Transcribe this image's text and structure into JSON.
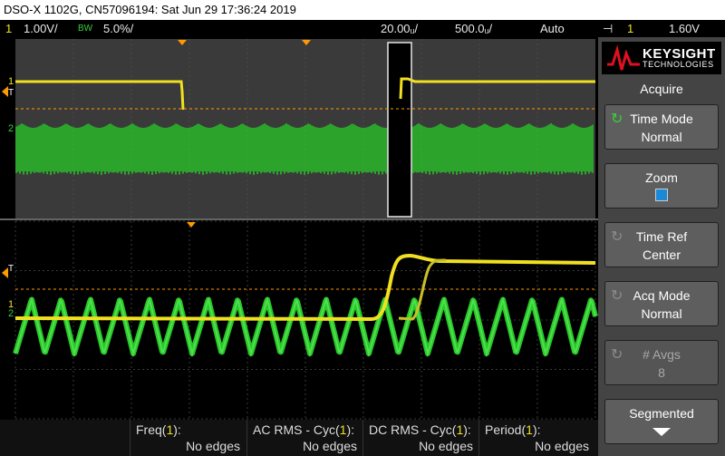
{
  "header": {
    "title": "DSO-X 1102G, CN57096194: Sat Jun 29 17:36:24 2019"
  },
  "status": {
    "ch1_num": "1",
    "ch1_scale": "1.00V/",
    "bw": "BW",
    "ch2_scale": "5.0%/",
    "time_scale": "20.00ᵤ/",
    "time_scale2": "500.0ᵤ/",
    "trigger_mode": "Auto",
    "trigger_symbol": "⊣",
    "trigger_ch": "1",
    "trigger_level": "1.60V"
  },
  "grid_markers": {
    "ch1": "1",
    "ch2": "2",
    "trigger": "T"
  },
  "sidebar": {
    "brand": "KEYSIGHT",
    "brand_sub": "TECHNOLOGIES",
    "menu_title": "Acquire",
    "keys": [
      {
        "label": "Time Mode",
        "value": "Normal",
        "icon": "rotate-icon"
      },
      {
        "label": "Zoom",
        "value": "",
        "icon": "checkbox-icon"
      },
      {
        "label": "Time Ref",
        "value": "Center",
        "icon": "rotate-icon"
      },
      {
        "label": "Acq Mode",
        "value": "Normal",
        "icon": "rotate-icon"
      },
      {
        "label": "# Avgs",
        "value": "8",
        "icon": "rotate-icon"
      },
      {
        "label": "Segmented",
        "value": "",
        "icon": "down-arrow-icon"
      }
    ]
  },
  "measurements": [
    {
      "name": "Freq",
      "ch": "1",
      "value": "No edges"
    },
    {
      "name": "AC RMS - Cyc",
      "ch": "1",
      "value": "No edges"
    },
    {
      "name": "DC RMS - Cyc",
      "ch": "1",
      "value": "No edges"
    },
    {
      "name": "Period",
      "ch": "1",
      "value": "No edges"
    }
  ],
  "colors": {
    "ch1": "#f0e020",
    "ch2": "#28c828",
    "grid": "#3c3c3c",
    "accent": "#ff9900"
  }
}
